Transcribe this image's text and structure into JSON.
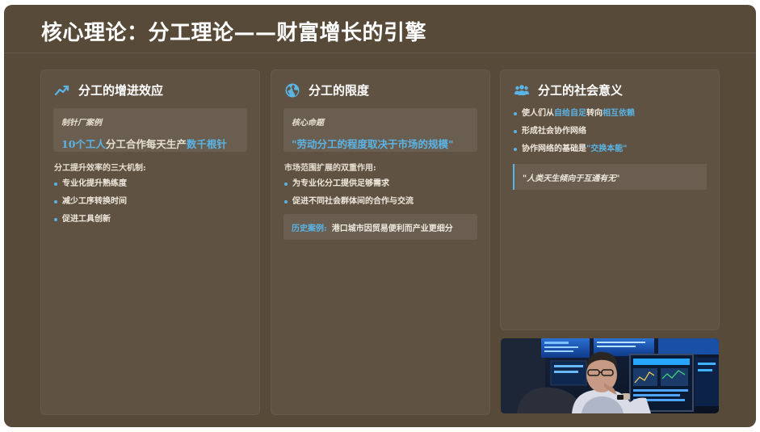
{
  "title": "核心理论：分工理论——财富增长的引擎",
  "colors": {
    "background": "#584a39",
    "card": "#5f5242",
    "highlight": "#5ab4e6"
  },
  "cards": [
    {
      "icon": "trend-up-icon",
      "title": "分工的增进效应",
      "box_label": "制针厂案例",
      "box_text": {
        "a": "10个工人",
        "b": "分工合作每天生产",
        "c": "数千根针"
      },
      "sub": "分工提升效率的三大机制:",
      "bullets": [
        "专业化提升熟练度",
        "减少工序转换时间",
        "促进工具创新"
      ]
    },
    {
      "icon": "globe-icon",
      "title": "分工的限度",
      "box_label": "核心命题",
      "box_text": "\"劳动分工的程度取决于市场的规模\"",
      "sub": "市场范围扩展的双重作用:",
      "bullets": [
        "为专业化分工提供足够需求",
        "促进不同社会群体间的合作与交流"
      ],
      "case_label": "历史案例:",
      "case_text": "港口城市因贸易便利而产业更细分"
    },
    {
      "icon": "users-icon",
      "title": "分工的社会意义",
      "bullets": [
        {
          "a": "使人们从",
          "b": "自给自足",
          "c": "转向",
          "d": "相互依赖"
        },
        "形成社会协作网络",
        {
          "a": "协作网络的基础是",
          "b": "\"交换本能\""
        }
      ],
      "quote": "\"人类天生倾向于互通有无\""
    }
  ]
}
